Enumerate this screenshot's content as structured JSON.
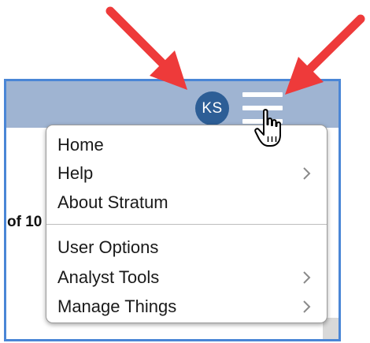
{
  "header": {
    "avatar_initials": "KS",
    "menu_button_icon": "hamburger-icon"
  },
  "background_text": "of 10",
  "menu": {
    "items": [
      {
        "label": "Home",
        "has_submenu": false
      },
      {
        "label": "Help",
        "has_submenu": true
      },
      {
        "label": "About Stratum",
        "has_submenu": false
      },
      {
        "label": "User Options",
        "has_submenu": false
      },
      {
        "label": "Analyst Tools",
        "has_submenu": true
      },
      {
        "label": "Manage Things",
        "has_submenu": true
      }
    ]
  },
  "annotations": {
    "arrow_color": "#ee3a3a",
    "arrows": [
      "arrow-to-avatar",
      "arrow-to-menu-button"
    ]
  },
  "colors": {
    "header_bar": "#9fb4d2",
    "window_border": "#4a86d6",
    "avatar_bg": "#2d5e96"
  }
}
